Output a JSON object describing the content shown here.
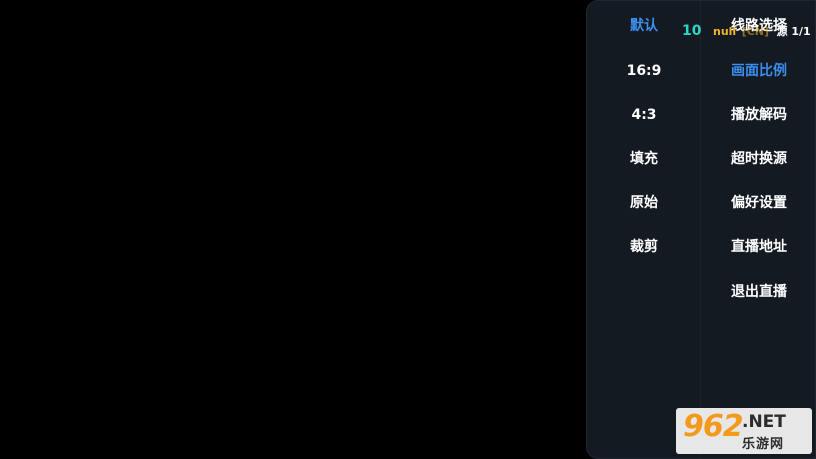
{
  "overlay": {
    "channel_number": "10",
    "channel_name": "null",
    "channel_tag": "[CN]",
    "source_label": "源 1/1"
  },
  "aspect_options": [
    {
      "label": "默认",
      "selected": true
    },
    {
      "label": "16:9",
      "selected": false
    },
    {
      "label": "4:3",
      "selected": false
    },
    {
      "label": "填充",
      "selected": false
    },
    {
      "label": "原始",
      "selected": false
    },
    {
      "label": "裁剪",
      "selected": false
    }
  ],
  "menu": [
    {
      "label": "线路选择",
      "selected": false
    },
    {
      "label": "画面比例",
      "selected": true
    },
    {
      "label": "播放解码",
      "selected": false
    },
    {
      "label": "超时换源",
      "selected": false
    },
    {
      "label": "偏好设置",
      "selected": false
    },
    {
      "label": "直播地址",
      "selected": false
    },
    {
      "label": "退出直播",
      "selected": false
    }
  ],
  "watermark": {
    "brand_number": "962",
    "brand_suffix": ".NET",
    "brand_cn": "乐游网"
  },
  "colors": {
    "background": "#000000",
    "panel": "#131a21",
    "accent_selected": "#3b8ff0",
    "channel_number": "#2fd4c8",
    "channel_name": "#f0b429",
    "watermark_orange": "#f39a1c"
  }
}
